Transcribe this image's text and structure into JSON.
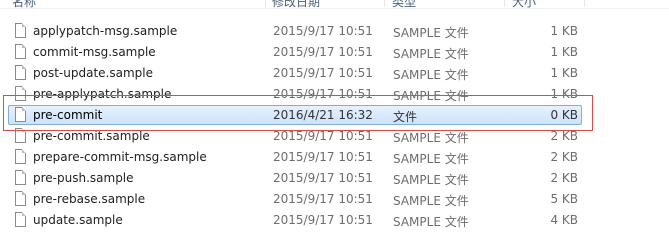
{
  "columns": {
    "name": "名称",
    "date": "修改日期",
    "type": "类型",
    "size": "大小"
  },
  "files": [
    {
      "name": "applypatch-msg.sample",
      "date": "2015/9/17 10:51",
      "type": "SAMPLE 文件",
      "size": "1 KB"
    },
    {
      "name": "commit-msg.sample",
      "date": "2015/9/17 10:51",
      "type": "SAMPLE 文件",
      "size": "1 KB"
    },
    {
      "name": "post-update.sample",
      "date": "2015/9/17 10:51",
      "type": "SAMPLE 文件",
      "size": "1 KB"
    },
    {
      "name": "pre-applypatch.sample",
      "date": "2015/9/17 10:51",
      "type": "SAMPLE 文件",
      "size": "1 KB"
    },
    {
      "name": "pre-commit",
      "date": "2016/4/21 16:32",
      "type": "文件",
      "size": "0 KB",
      "selected": true
    },
    {
      "name": "pre-commit.sample",
      "date": "2015/9/17 10:51",
      "type": "SAMPLE 文件",
      "size": "2 KB"
    },
    {
      "name": "prepare-commit-msg.sample",
      "date": "2015/9/17 10:51",
      "type": "SAMPLE 文件",
      "size": "2 KB"
    },
    {
      "name": "pre-push.sample",
      "date": "2015/9/17 10:51",
      "type": "SAMPLE 文件",
      "size": "2 KB"
    },
    {
      "name": "pre-rebase.sample",
      "date": "2015/9/17 10:51",
      "type": "SAMPLE 文件",
      "size": "5 KB"
    },
    {
      "name": "update.sample",
      "date": "2015/9/17 10:51",
      "type": "SAMPLE 文件",
      "size": "4 KB"
    }
  ],
  "colors": {
    "selection_fill": "#cce3fb",
    "selection_border": "#84acdd",
    "annotation_border": "#d94a48"
  },
  "icons": {
    "file": "file-icon"
  }
}
